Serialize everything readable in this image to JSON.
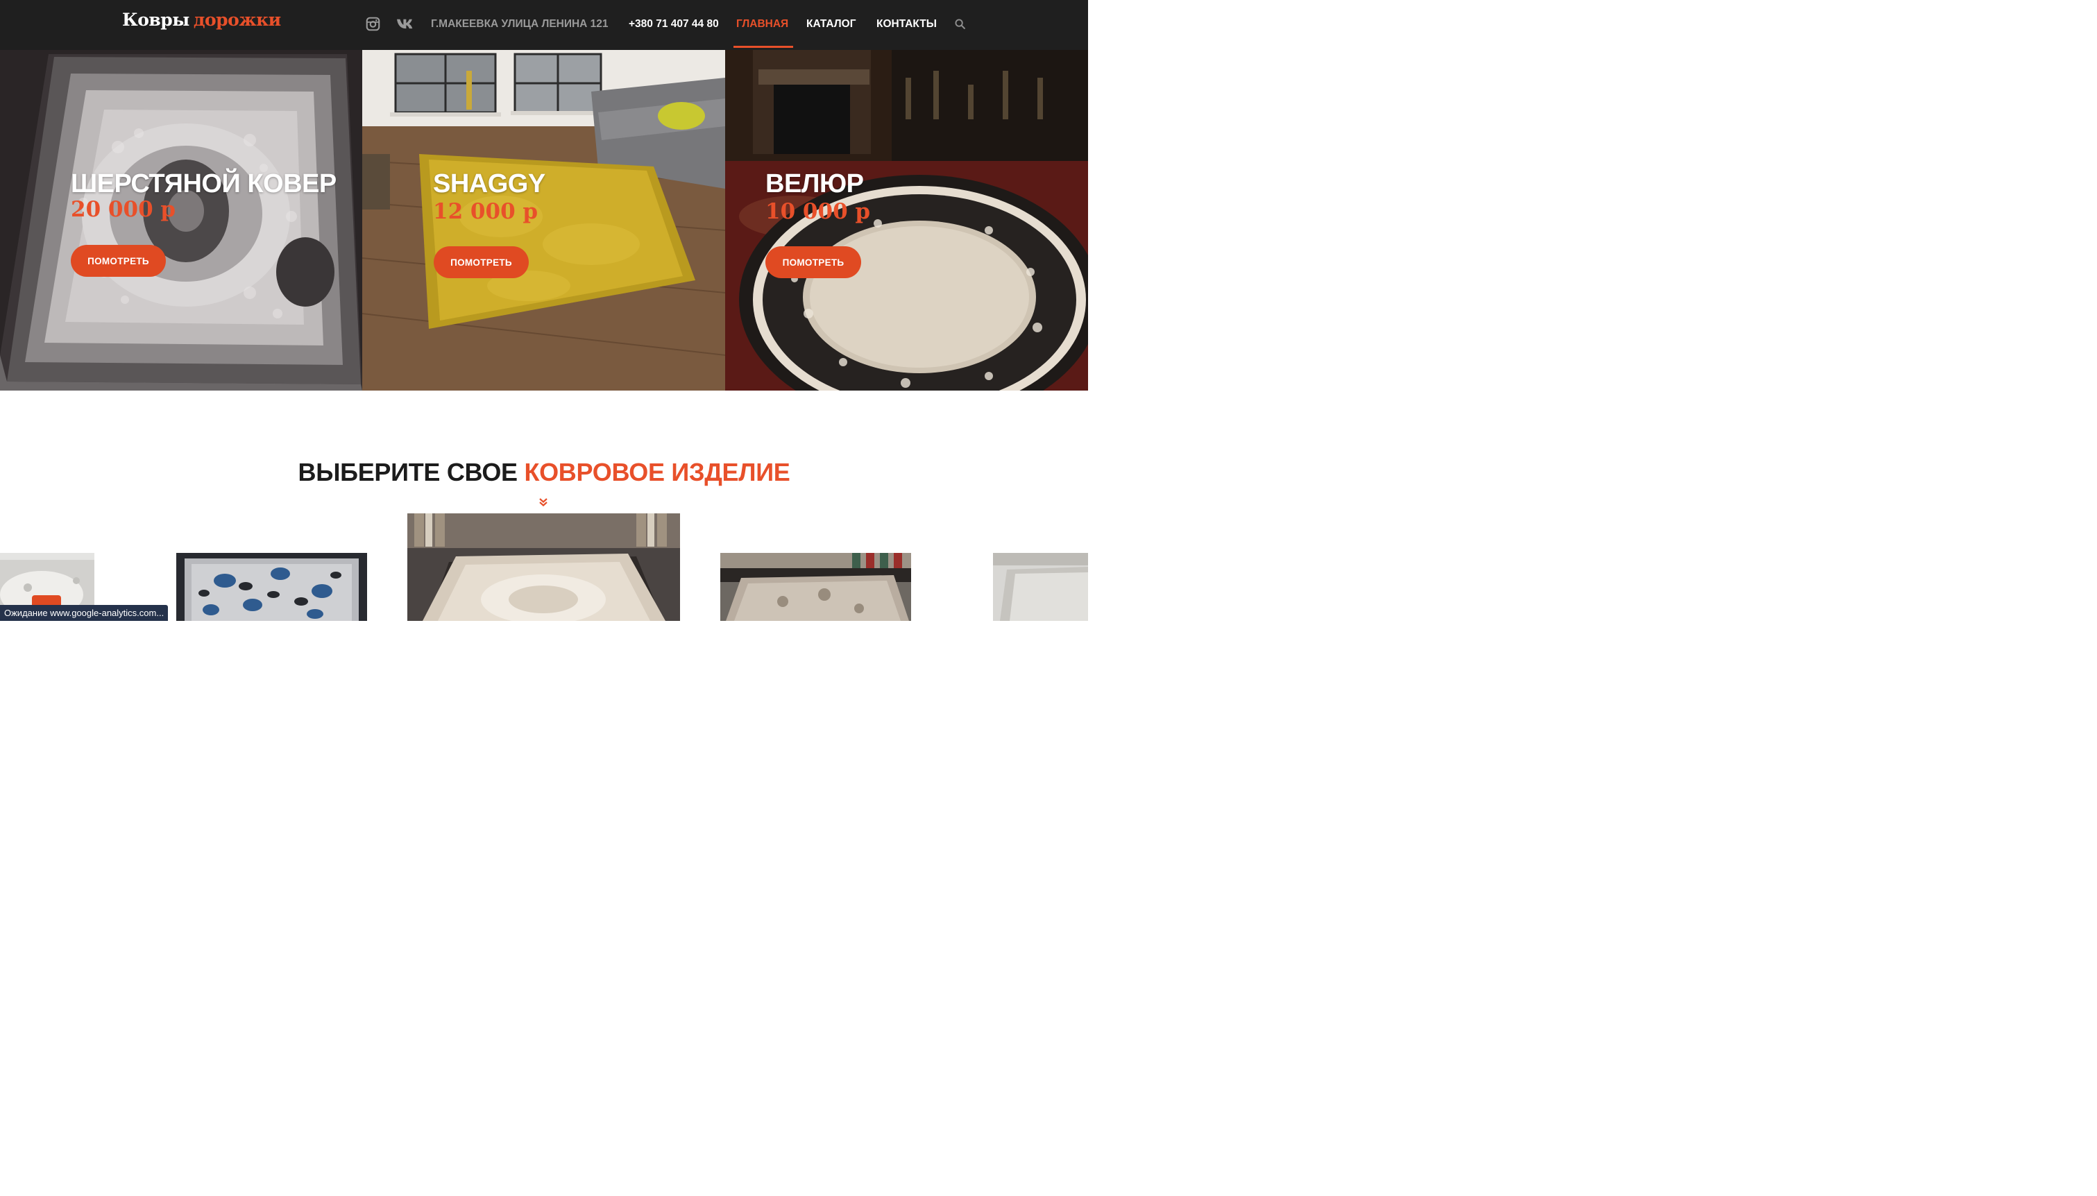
{
  "header": {
    "logo_part1": "Ковры",
    "logo_part2": "дорожки",
    "address": "Г.МАКЕЕВКА УЛИЦА ЛЕНИНА 121",
    "phone": "+380 71 407 44 80",
    "nav": {
      "home": "ГЛАВНАЯ",
      "catalog": "КАТАЛОГ",
      "contacts": "КОНТАКТЫ"
    },
    "icons": [
      "instagram-icon",
      "vk-icon",
      "search-icon"
    ]
  },
  "slides": [
    {
      "title": "ШЕРСТЯНОЙ КОВЕР",
      "price": "20 000 р",
      "button": "ПОМОТРЕТЬ"
    },
    {
      "title": "SHAGGY",
      "price": "12 000 р",
      "button": "ПОМОТРЕТЬ"
    },
    {
      "title": "ВЕЛЮР",
      "price": "10 000 р",
      "button": "ПОМОТРЕТЬ"
    }
  ],
  "section": {
    "title_dark": "ВЫБЕРИТЕ СВОЕ",
    "title_accent": "КОВРОВОЕ ИЗДЕЛИЕ"
  },
  "status_bar": "Ожидание www.google-analytics.com...",
  "colors": {
    "accent": "#e8502a",
    "header_bg": "#1f1f1f",
    "button": "#e04a22"
  }
}
